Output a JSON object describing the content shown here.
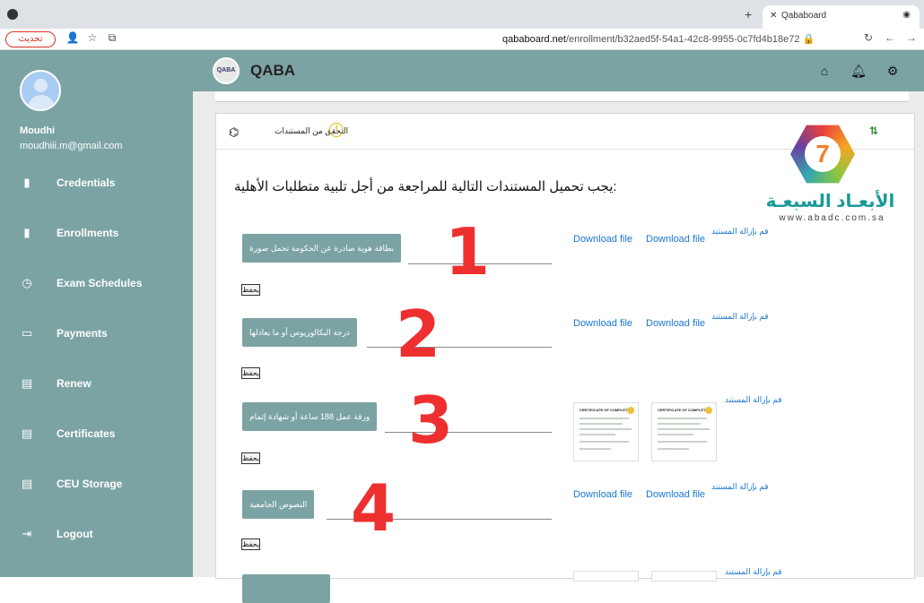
{
  "browser": {
    "tab_title": "Qababoard",
    "update_label": "تحديث",
    "url_host": "qababoard.net",
    "url_path": "/enrollment/b32aed5f-54a1-42c8-9955-0c7fd4b18e72"
  },
  "user": {
    "name": "Moudhi",
    "email": "moudhiii.m@gmail.com"
  },
  "sidebar": {
    "items": [
      {
        "label": "Credentials",
        "icon": "bookmark-icon"
      },
      {
        "label": "Enrollments",
        "icon": "bookmark-icon"
      },
      {
        "label": "Exam Schedules",
        "icon": "clock-icon"
      },
      {
        "label": "Payments",
        "icon": "credit-card-icon"
      },
      {
        "label": "Renew",
        "icon": "clipboard-icon"
      },
      {
        "label": "Certificates",
        "icon": "clipboard-icon"
      },
      {
        "label": "CEU Storage",
        "icon": "clipboard-icon"
      },
      {
        "label": "Logout",
        "icon": "logout-icon"
      }
    ]
  },
  "header": {
    "brand": "QABA",
    "logo_text": "QABA"
  },
  "card": {
    "title": "التحقق من المستندات",
    "heading": "يجب تحميل المستندات التالية للمراجعة من أجل تلبية متطلبات الأهلية:"
  },
  "documents": [
    {
      "label": "بطاقة هوية صادرة عن الحكومة تحمل صورة",
      "number": "1",
      "save": "يحفظ",
      "download_1": "Download file",
      "download_2": "Download file",
      "remove": "قم بإزالة المستند"
    },
    {
      "label": "درجة البكالوريوس أو ما يعادلها",
      "number": "2",
      "save": "يحفظ",
      "download_1": "Download file",
      "download_2": "Download file",
      "remove": "قم بإزالة المستند"
    },
    {
      "label": "ورقة عمل 188 ساعة أو شهادة إتمام",
      "number": "3",
      "save": "يحفظ",
      "thumb_title": "CERTIFICATE OF COMPLETION",
      "remove": "قم بإزالة المستند"
    },
    {
      "label": "النصوص الجامعية",
      "number": "4",
      "save": "يحفظ",
      "download_1": "Download file",
      "download_2": "Download file",
      "remove": "قم بإزالة المستند"
    },
    {
      "remove": "قم بإزالة المستند"
    }
  ],
  "watermark": {
    "arabic": "الأبعـاد السبعـة",
    "site": "www.abadc.com.sa"
  }
}
